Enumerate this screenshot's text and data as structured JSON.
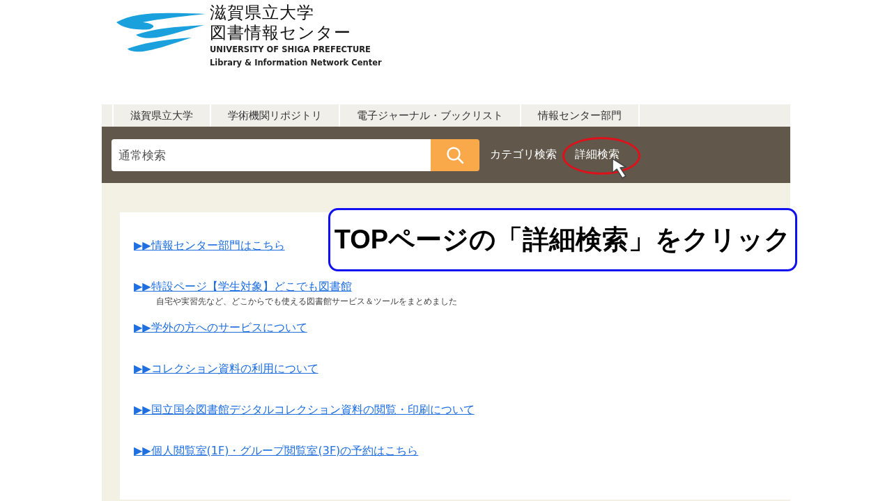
{
  "logo": {
    "title_lines": [
      "滋賀県立大学",
      "図書情報センター"
    ],
    "english_lines": [
      "UNIVERSITY OF SHIGA PREFECTURE",
      "Library & Information Network Center"
    ]
  },
  "nav_tabs": [
    {
      "label": "滋賀県立大学"
    },
    {
      "label": "学術機関リポジトリ"
    },
    {
      "label": "電子ジャーナル・ブックリスト"
    },
    {
      "label": "情報センター部門"
    }
  ],
  "search": {
    "placeholder": "通常検索",
    "links": [
      {
        "label": "カテゴリ検索",
        "highlighted": false
      },
      {
        "label": "詳細検索",
        "highlighted": true
      }
    ]
  },
  "links": [
    {
      "text": "▶▶情報センター部門はこちら"
    },
    {
      "text": "▶▶特設ページ【学生対象】どこでも図書館",
      "note": "自宅や実習先など、どこからでも使える図書館サービス＆ツールをまとめました"
    },
    {
      "text": "▶▶学外の方へのサービスについて"
    },
    {
      "text": "▶▶コレクション資料の利用について"
    },
    {
      "text": "▶▶国立国会図書館デジタルコレクション資料の閲覧・印刷について"
    },
    {
      "text": "▶▶個人閲覧室(1F)・グループ閲覧室(3F)の予約はこちら"
    }
  ],
  "callout": {
    "text": "TOPページの「詳細検索」をクリック"
  }
}
